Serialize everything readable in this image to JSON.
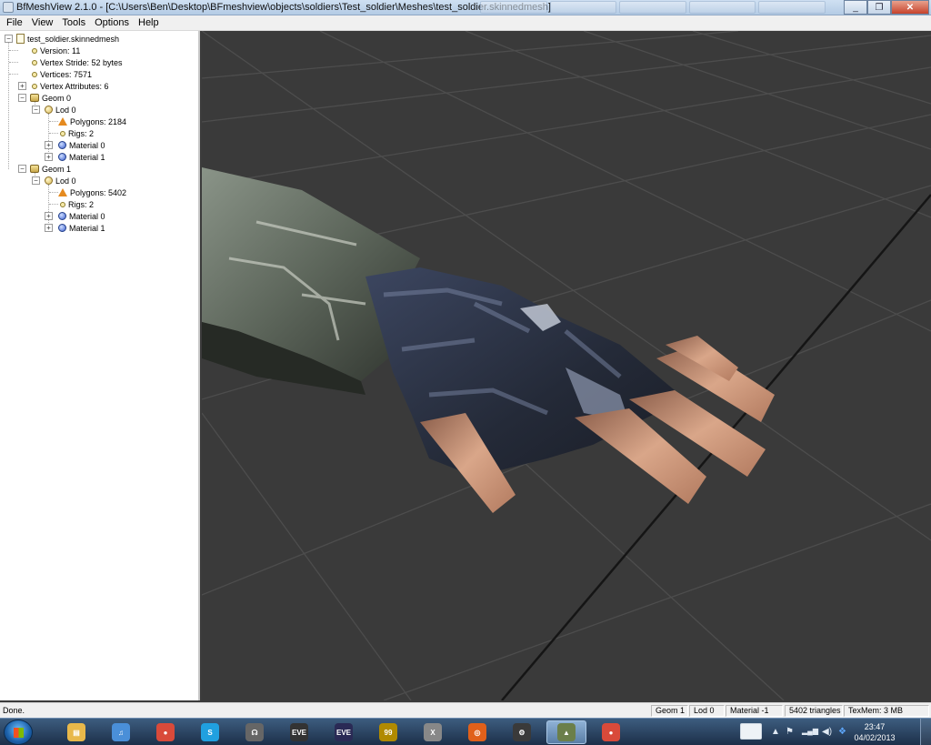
{
  "window": {
    "title": "BfMeshView 2.1.0 - [C:\\Users\\Ben\\Desktop\\BFmeshview\\objects\\soldiers\\Test_soldier\\Meshes\\test_soldier.skinnedmesh]",
    "minimize_glyph": "_",
    "maximize_glyph": "❐",
    "close_glyph": "✕"
  },
  "menu": [
    "File",
    "View",
    "Tools",
    "Options",
    "Help"
  ],
  "tree": {
    "root": "test_soldier.skinnedmesh",
    "version": "Version: 11",
    "vertex_stride": "Vertex Stride: 52 bytes",
    "vertices": "Vertices: 7571",
    "vertex_attributes": "Vertex Attributes: 6",
    "geom0": {
      "label": "Geom 0",
      "lod": "Lod 0",
      "polygons": "Polygons: 2184",
      "rigs": "Rigs: 2",
      "material0": "Material 0",
      "material1": "Material 1"
    },
    "geom1": {
      "label": "Geom 1",
      "lod": "Lod 0",
      "polygons": "Polygons: 5402",
      "rigs": "Rigs: 2",
      "material0": "Material 0",
      "material1": "Material 1"
    }
  },
  "status": {
    "text": "Done.",
    "geom": "Geom 1",
    "lod": "Lod 0",
    "material": "Material -1",
    "triangles": "5402 triangles",
    "texmem": "TexMem: 3 MB"
  },
  "taskbar": {
    "apps": [
      {
        "name": "windows-explorer",
        "glyph": "▤",
        "color": "#e8b84a"
      },
      {
        "name": "itunes",
        "glyph": "♫",
        "color": "#4a8fd8"
      },
      {
        "name": "chrome",
        "glyph": "●",
        "color": "#d94a3a"
      },
      {
        "name": "skype",
        "glyph": "S",
        "color": "#20a0e0"
      },
      {
        "name": "headset",
        "glyph": "☊",
        "color": "#666"
      },
      {
        "name": "eve",
        "glyph": "EVE",
        "color": "#333"
      },
      {
        "name": "evemon",
        "glyph": "EVE",
        "color": "#2a2a55"
      },
      {
        "name": "99",
        "glyph": "99",
        "color": "#b08a00"
      },
      {
        "name": "xsplit",
        "glyph": "X",
        "color": "#888"
      },
      {
        "name": "origin",
        "glyph": "◎",
        "color": "#e0601a"
      },
      {
        "name": "steam",
        "glyph": "⚙",
        "color": "#3a3a3a"
      },
      {
        "name": "bfmeshview",
        "glyph": "▲",
        "color": "#6b7f4a"
      },
      {
        "name": "chrome-2",
        "glyph": "●",
        "color": "#d94a3a"
      }
    ],
    "time": "23:47",
    "date": "04/02/2013",
    "tray_up": "▲",
    "tray_flag": "⚑",
    "tray_signal": "▂▄▆",
    "tray_volume": "◀)",
    "tray_dropbox": "❖"
  },
  "colors": {
    "viewport_bg": "#3a3a3a",
    "grid_line": "#4c4c4c",
    "axis_line": "#141414",
    "taskbar": "#2a4466"
  }
}
